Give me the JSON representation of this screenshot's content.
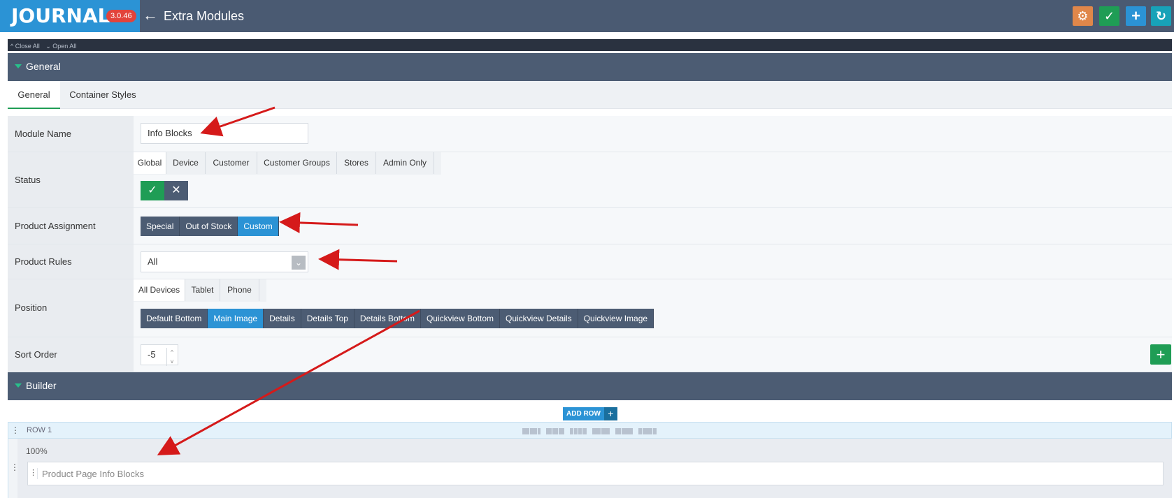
{
  "app": {
    "logo": "JOURNAL",
    "version": "3.0.46",
    "title": "Extra Modules",
    "colors": {
      "header_bg": "#4a5a72",
      "logo_bg": "#2b93d5",
      "accent_green": "#1f9d55",
      "accent_blue": "#2b93d5",
      "accent_orange": "#e0874a",
      "accent_teal": "#17a2b8",
      "arrow_red": "#d51a1a"
    }
  },
  "toolbar": {
    "buttons": [
      {
        "name": "support-icon",
        "color": "#e0874a",
        "glyph": "⚙"
      },
      {
        "name": "save-check-icon",
        "color": "#1f9d55",
        "glyph": "✓"
      },
      {
        "name": "add-plus-icon",
        "color": "#2b93d5",
        "glyph": "+"
      },
      {
        "name": "history-icon",
        "color": "#17a2b8",
        "glyph": "↻"
      }
    ]
  },
  "strip": {
    "close_all": "^ Close All",
    "open_all": "⌄ Open All"
  },
  "general_section": {
    "title": "General",
    "tabs": [
      "General",
      "Container Styles"
    ],
    "fields": {
      "module_name": {
        "label": "Module Name",
        "value": "Info Blocks"
      },
      "status": {
        "label": "Status",
        "tabs": [
          "Global",
          "Device",
          "Customer",
          "Customer Groups",
          "Stores",
          "Admin Only"
        ],
        "on_glyph": "✓",
        "off_glyph": "✕"
      },
      "product_assignment": {
        "label": "Product Assignment",
        "options": [
          "Special",
          "Out of Stock",
          "Custom"
        ],
        "selected": "Custom"
      },
      "product_rules": {
        "label": "Product Rules",
        "value": "All",
        "arrow": "⌄"
      },
      "position": {
        "label": "Position",
        "tabs": [
          "All Devices",
          "Tablet",
          "Phone"
        ],
        "options": [
          "Default Bottom",
          "Main Image",
          "Details",
          "Details Top",
          "Details Bottom",
          "Quickview Bottom",
          "Quickview Details",
          "Quickview Image"
        ],
        "selected": "Main Image"
      },
      "sort_order": {
        "label": "Sort Order",
        "value": "-5",
        "up": "^",
        "down": "v"
      }
    }
  },
  "builder_section": {
    "title": "Builder",
    "add_row_label": "ADD ROW",
    "add_row_glyph": "+",
    "row_label": "ROW 1",
    "column_width": "100%",
    "module_placeholder": "Product Page Info Blocks"
  }
}
